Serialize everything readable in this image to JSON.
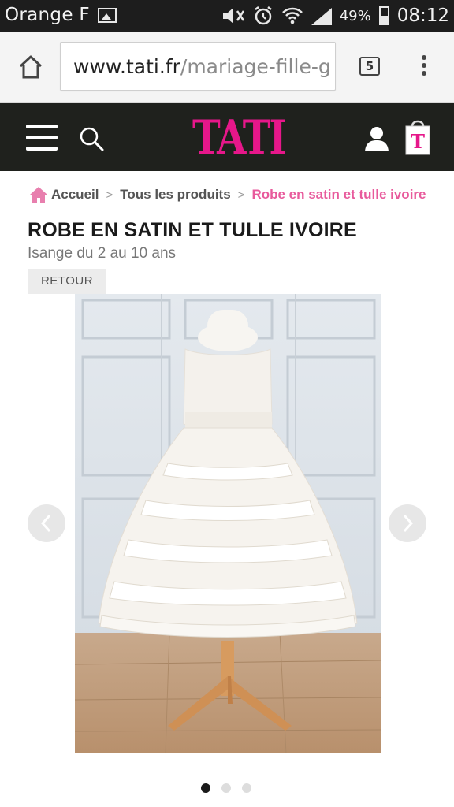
{
  "status_bar": {
    "carrier": "Orange F",
    "battery": "49%",
    "time": "08:12",
    "icons": [
      "image-icon",
      "mute-icon",
      "alarm-icon",
      "wifi-icon",
      "signal-icon",
      "battery-icon"
    ]
  },
  "browser": {
    "url_host": "www.tati.fr",
    "url_path": "/mariage-fille-g",
    "tab_count": "5"
  },
  "site": {
    "logo": "TATI",
    "brand_color": "#e6178a"
  },
  "breadcrumb": {
    "home": "Accueil",
    "separator": ">",
    "level1": "Tous les produits",
    "current": "Robe en satin et tulle ivoire"
  },
  "product": {
    "title": "ROBE EN SATIN ET TULLE IVOIRE",
    "subtitle": "Isange du 2 au 10 ans",
    "back_label": "RETOUR"
  },
  "carousel": {
    "prev_arrow": "‹",
    "next_arrow": "›",
    "total_slides": 3,
    "active_slide": 1
  }
}
